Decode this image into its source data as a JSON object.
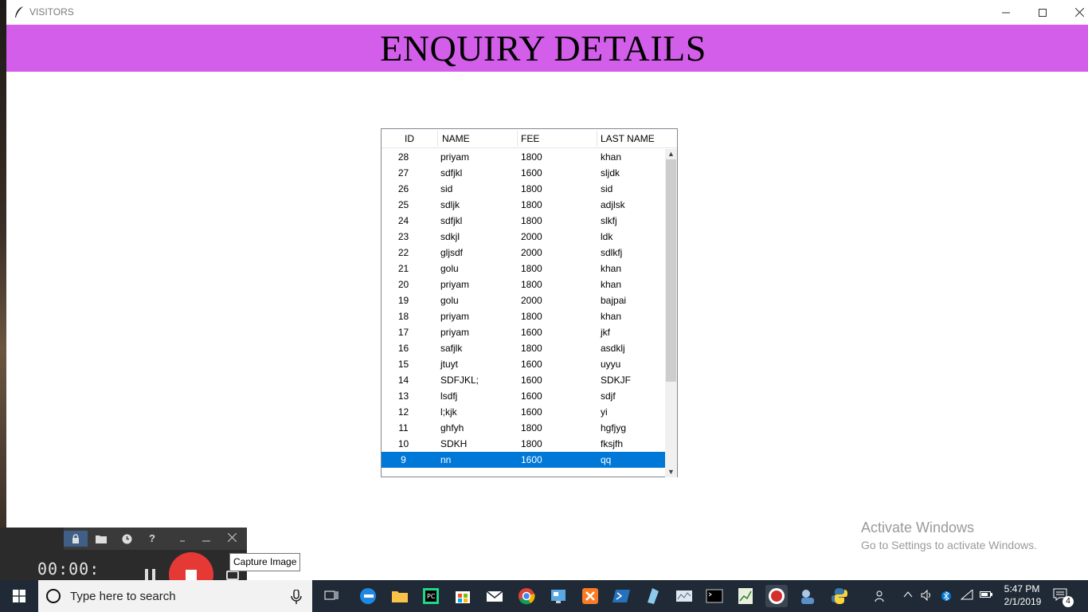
{
  "window": {
    "title": "VISITORS",
    "minimize_icon": "minimize-icon",
    "maximize_icon": "maximize-icon",
    "close_icon": "close-icon"
  },
  "header": {
    "title": "ENQUIRY DETAILS",
    "color": "#d35eea"
  },
  "table": {
    "columns": [
      "ID",
      "NAME",
      "FEE",
      "LAST NAME"
    ],
    "rows": [
      {
        "id": "28",
        "name": "priyam",
        "fee": "1800",
        "last": "khan"
      },
      {
        "id": "27",
        "name": "sdfjkl",
        "fee": "1600",
        "last": "sljdk"
      },
      {
        "id": "26",
        "name": "sid",
        "fee": "1800",
        "last": "sid"
      },
      {
        "id": "25",
        "name": "sdljk",
        "fee": "1800",
        "last": "adjlsk"
      },
      {
        "id": "24",
        "name": "sdfjkl",
        "fee": "1800",
        "last": "slkfj"
      },
      {
        "id": "23",
        "name": "sdkjl",
        "fee": "2000",
        "last": "ldk"
      },
      {
        "id": "22",
        "name": "gljsdf",
        "fee": "2000",
        "last": "sdlkfj"
      },
      {
        "id": "21",
        "name": "golu",
        "fee": "1800",
        "last": "khan"
      },
      {
        "id": "20",
        "name": "priyam",
        "fee": "1800",
        "last": "khan"
      },
      {
        "id": "19",
        "name": "golu",
        "fee": "2000",
        "last": "bajpai"
      },
      {
        "id": "18",
        "name": "priyam",
        "fee": "1800",
        "last": "khan"
      },
      {
        "id": "17",
        "name": "priyam",
        "fee": "1600",
        "last": "jkf"
      },
      {
        "id": "16",
        "name": "safjlk",
        "fee": "1800",
        "last": "asdklj"
      },
      {
        "id": "15",
        "name": "jtuyt",
        "fee": "1600",
        "last": "uyyu"
      },
      {
        "id": "14",
        "name": "SDFJKL;",
        "fee": "1600",
        "last": "SDKJF"
      },
      {
        "id": "13",
        "name": "lsdfj",
        "fee": "1600",
        "last": "sdjf"
      },
      {
        "id": "12",
        "name": "l;kjk",
        "fee": "1600",
        "last": "yi"
      },
      {
        "id": "11",
        "name": "ghfyh",
        "fee": "1800",
        "last": "hgfjyg"
      },
      {
        "id": "10",
        "name": "SDKH",
        "fee": "1800",
        "last": "fksjfh"
      },
      {
        "id": "9",
        "name": "nn",
        "fee": "1600",
        "last": "qq"
      }
    ],
    "selected_row_id": "9",
    "selection_color": "#0078d7"
  },
  "watermark": {
    "line1": "Activate Windows",
    "line2": "Go to Settings to activate Windows."
  },
  "recorder": {
    "timer": "00:00:",
    "tooltip": "Capture Image",
    "help_label": "?",
    "stop_color": "#e53935"
  },
  "taskbar": {
    "search_placeholder": "Type here to search",
    "time": "5:47 PM",
    "date": "2/1/2019",
    "notification_count": "4"
  }
}
